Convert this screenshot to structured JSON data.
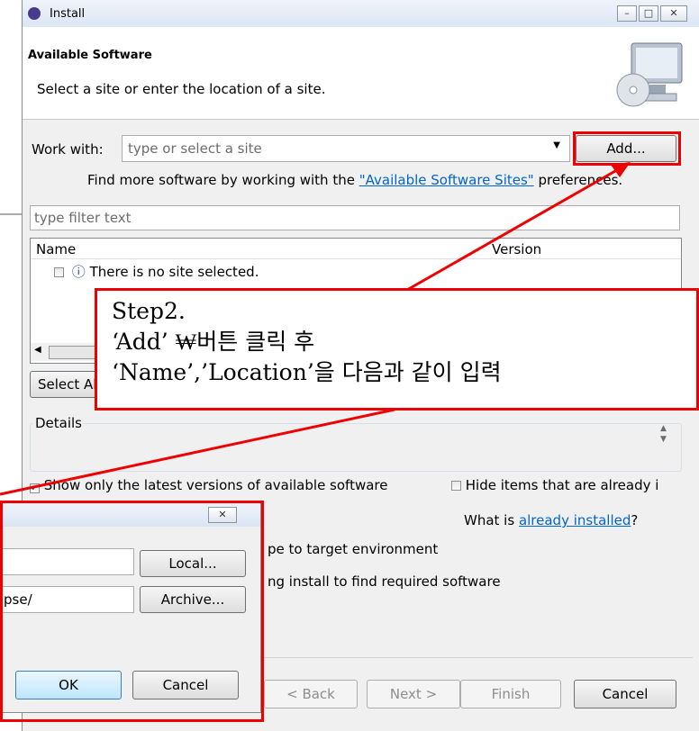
{
  "window": {
    "title": "Install",
    "minimize": "–",
    "maximize": "□",
    "close": "✕"
  },
  "banner": {
    "title": "Available Software",
    "subtitle": "Select a site or enter the location of a site."
  },
  "work_with": {
    "label": "Work with:",
    "placeholder": "type or select a site",
    "add_label": "Add..."
  },
  "find_more": {
    "prefix": "Find more software by working with the ",
    "link": "\"Available Software Sites\"",
    "suffix": " preferences."
  },
  "filter": {
    "placeholder": "type filter text"
  },
  "table": {
    "col_name": "Name",
    "col_version": "Version",
    "row_info_icon": "ⓘ",
    "row_text": "There is no site selected."
  },
  "select_all_label": "Select All",
  "details": {
    "label": "Details"
  },
  "options": {
    "show_latest": "Show only the latest versions of available software",
    "hide_installed": "Hide items that are already i",
    "what_is": "What is ",
    "already_installed": "already installed",
    "what_is_suffix": "?",
    "group_label": "pe to target environment",
    "contact_label": "ng install to find required software"
  },
  "footer": {
    "back": "< Back",
    "next": "Next >",
    "finish": "Finish",
    "cancel": "Cancel"
  },
  "dialog": {
    "close": "✕",
    "location_value": "pse/",
    "local_label": "Local...",
    "archive_label": "Archive...",
    "ok_label": "OK",
    "cancel_label": "Cancel"
  },
  "callout": {
    "line1": "Step2.",
    "line2": "‘Add’ ₩버튼 클릭 후",
    "line3": "‘Name’,’Location’을 다음과 같이 입력"
  },
  "colors": {
    "highlight": "#e00000",
    "link": "#0066cc"
  }
}
